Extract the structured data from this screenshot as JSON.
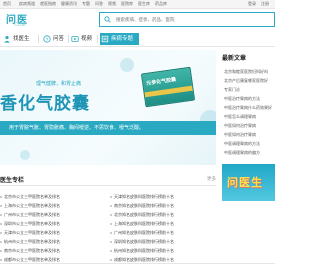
{
  "topbar": [
    "首页",
    "疾病频道",
    "就医指南",
    "健康资讯",
    "专题",
    "问答",
    "视频",
    "医院库",
    "医生库",
    "药品库",
    "登录",
    "注册"
  ],
  "header": {
    "logo_main": "问医",
    "logo_sub": "COM",
    "search_placeholder": "搜索疾病、症状、药品、医院"
  },
  "nav": [
    {
      "label": "找医生",
      "icon": "doctor-icon",
      "active": false
    },
    {
      "label": "问答",
      "icon": "question-icon",
      "active": false
    },
    {
      "label": "视频",
      "icon": "video-icon",
      "active": false
    },
    {
      "label": "疾病专题",
      "icon": "topic-icon",
      "active": true
    }
  ],
  "banner": {
    "tagline": "理气健脾，和胃止痛",
    "title": "香化气胶囊",
    "box_label": "元参化气胶囊",
    "desc": "用于胃脘气胀、胃隐胀痛、胸闷嗳逆、不思饮食、嗳气泛酸。"
  },
  "sidebar": {
    "title": "最新文章",
    "items": [
      "北京和睦家医院妇科好吗",
      "北京产后康复哪家医院好",
      "专家门诊",
      "中医治疗胃病的方法",
      "中医治疗胃病什么药效果好",
      "中医怎么调理胃病",
      "中医如何治疗胃病",
      "中医如何治疗胃病",
      "中医调理胃病的方法",
      "中医调理胃病的偏方"
    ],
    "ad_text": "问医生"
  },
  "section": {
    "title": "医生专栏",
    "more": "更多",
    "left_rows": [
      "北京市公立三甲医院名单及排名",
      "上海市公立三甲医院名单及排名",
      "广州市公立三甲医院名单及排名",
      "深圳市公立三甲医院名单及排名",
      "天津市公立三甲医院名单及排名",
      "杭州市公立三甲医院名单及排名",
      "南京市公立三甲医院名单及排名",
      "成都市公立三甲医院名单及排名"
    ],
    "right_rows": [
      "天津知名皮肤科医院排行榜前十名",
      "南京知名皮肤科医院排行榜前十名",
      "北京知名皮肤科医院排行榜前十名",
      "上海知名皮肤科医院排行榜前十名",
      "广州知名皮肤科医院排行榜前十名",
      "深圳知名皮肤科医院排行榜前十名",
      "杭州知名皮肤科医院排行榜前十名",
      "成都知名皮肤科医院排行榜前十名"
    ]
  },
  "colors": {
    "accent": "#2aa9c2",
    "banner_title": "#1f95b5"
  }
}
